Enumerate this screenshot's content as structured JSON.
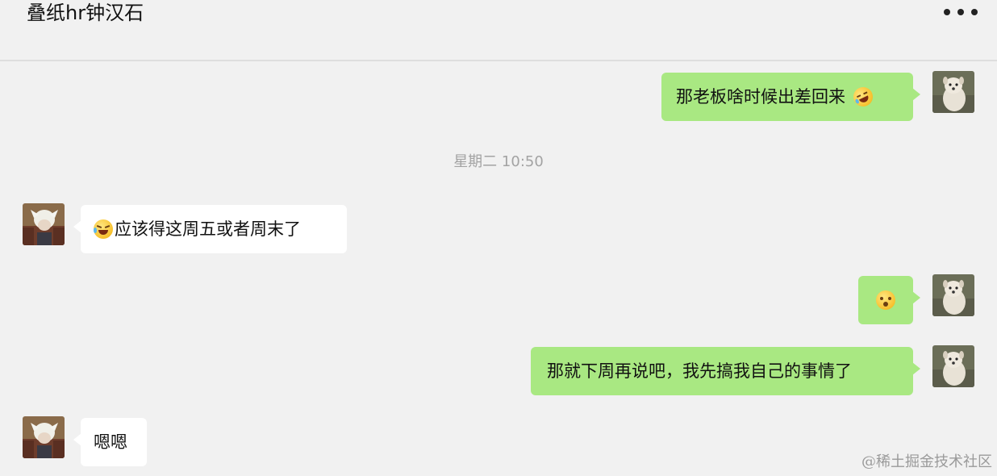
{
  "header": {
    "title": "叠纸hr钟汉石"
  },
  "messages": [
    {
      "sender": "me",
      "text": "那老板啥时候出差回来",
      "emoji_after": "rolling-laughing-emoji"
    },
    {
      "sender": "them",
      "text": "应该得这周五或者周末了",
      "emoji_before": "joy-emoji"
    },
    {
      "sender": "me",
      "text": "",
      "emoji_only": "hushed-emoji"
    },
    {
      "sender": "me",
      "text": "那就下周再说吧，我先搞我自己的事情了"
    },
    {
      "sender": "them",
      "text": "嗯嗯"
    }
  ],
  "timestamp": "星期二 10:50",
  "watermark": "@稀土掘金技术社区",
  "colors": {
    "background": "#f1f1f1",
    "my_bubble": "#a9e882",
    "their_bubble": "#ffffff",
    "timestamp_text": "#a3a3a3"
  }
}
